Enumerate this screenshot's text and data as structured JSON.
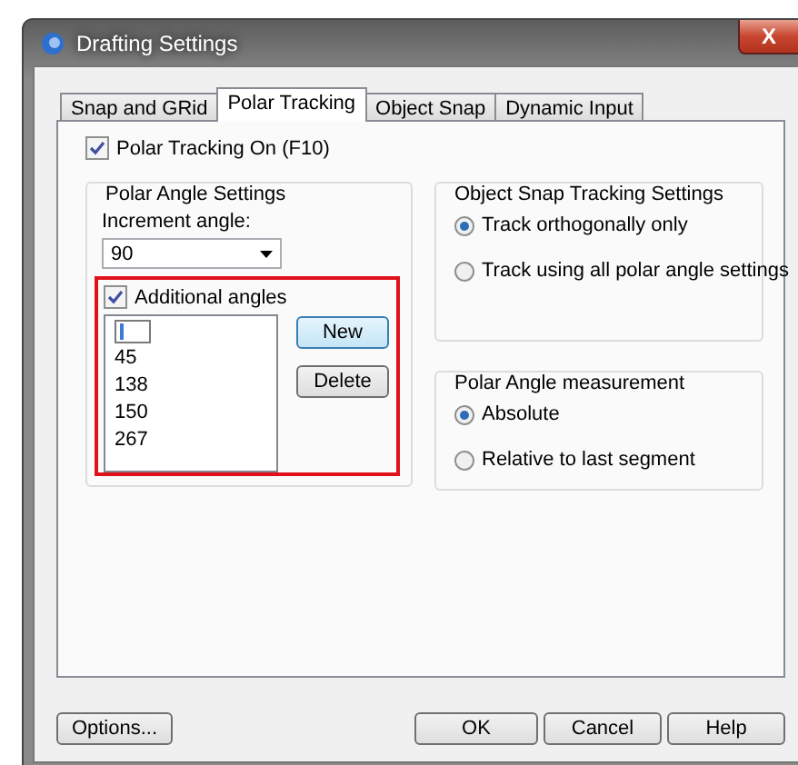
{
  "window": {
    "title": "Drafting Settings",
    "close": "X"
  },
  "tabs": [
    {
      "label": "Snap and GRid",
      "selected": false
    },
    {
      "label": "Polar Tracking",
      "selected": true
    },
    {
      "label": "Object Snap",
      "selected": false
    },
    {
      "label": "Dynamic Input",
      "selected": false
    }
  ],
  "polar_tracking_on": {
    "label": "Polar Tracking On (F10)",
    "checked": true
  },
  "polar_angle_settings": {
    "title": "Polar Angle Settings",
    "increment_label": "Increment angle:",
    "increment_value": "90",
    "additional_angles": {
      "label": "Additional angles",
      "checked": true,
      "highlighted": true,
      "editing_new_entry": true,
      "angles": [
        "45",
        "138",
        "150",
        "267"
      ],
      "buttons": [
        {
          "label": "New",
          "focused": true
        },
        {
          "label": "Delete",
          "focused": false
        }
      ]
    }
  },
  "object_snap_tracking": {
    "title": "Object Snap Tracking Settings",
    "options": [
      {
        "label": "Track orthogonally only",
        "selected": true
      },
      {
        "label": "Track using all polar angle settings",
        "selected": false
      }
    ]
  },
  "polar_angle_measurement": {
    "title": "Polar Angle measurement",
    "options": [
      {
        "label": "Absolute",
        "selected": true
      },
      {
        "label": "Relative to last segment",
        "selected": false
      }
    ]
  },
  "footer": {
    "options_button": "Options...",
    "buttons": [
      "OK",
      "Cancel",
      "Help"
    ]
  }
}
